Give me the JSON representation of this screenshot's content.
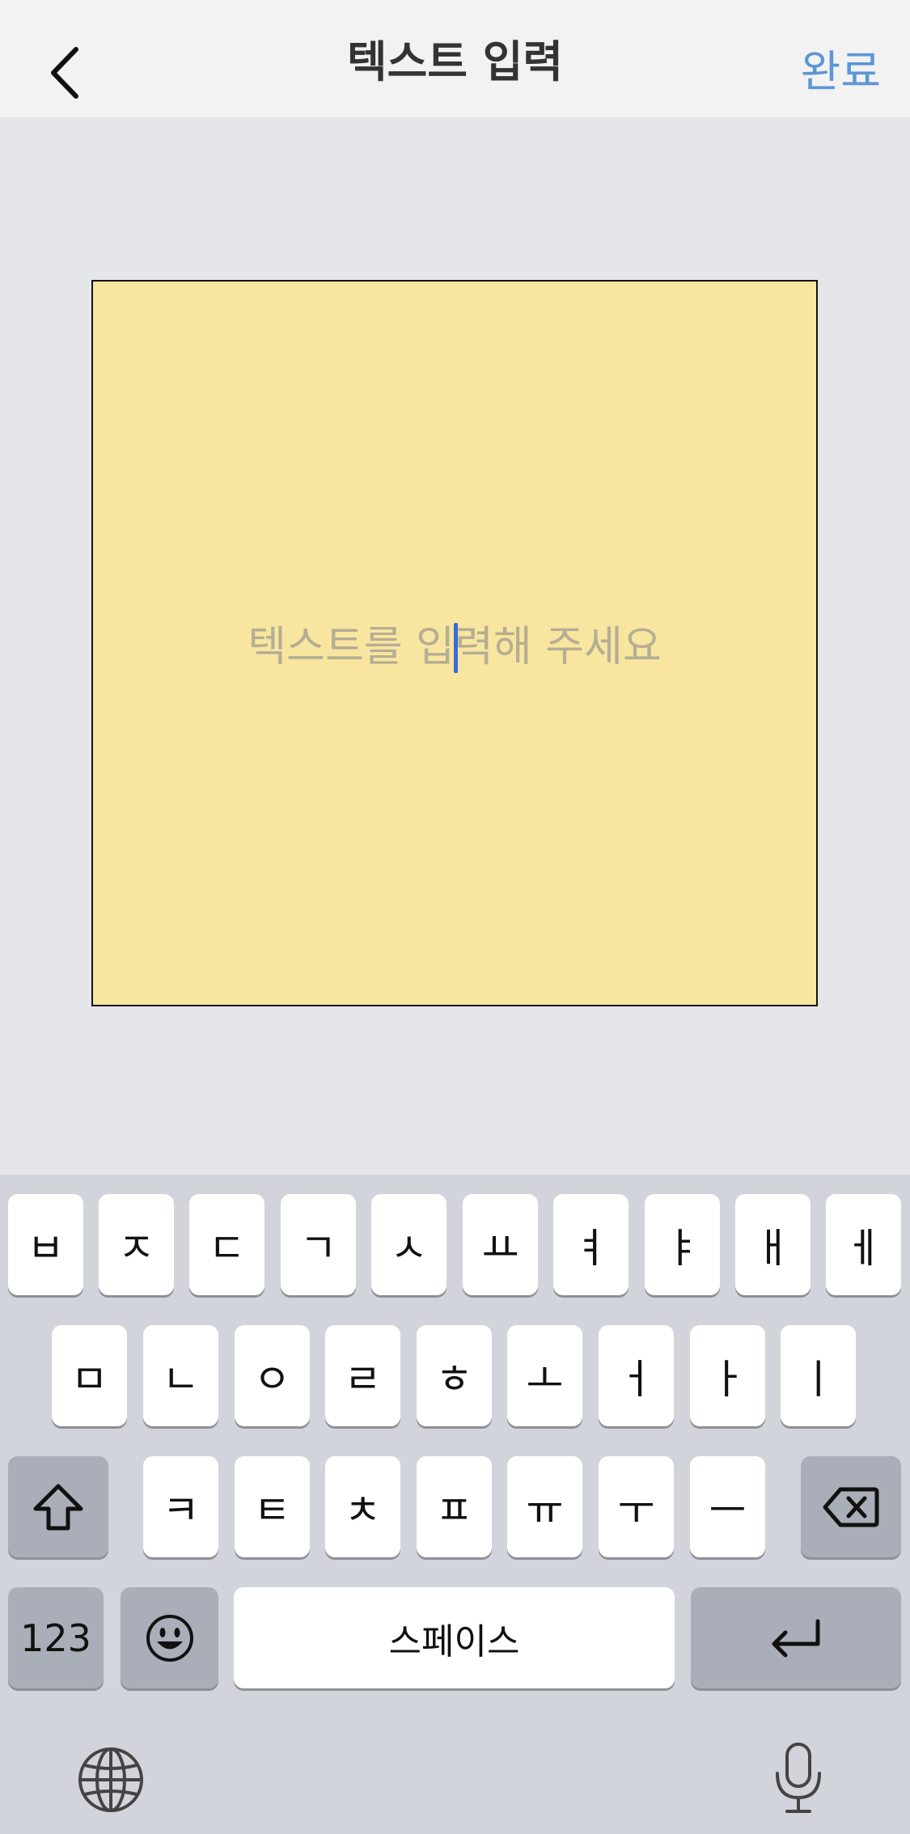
{
  "header": {
    "title": "텍스트 입력",
    "done_label": "완료"
  },
  "editor": {
    "placeholder": "텍스트를 입력해 주세요",
    "background_color": "#f8e59f"
  },
  "keyboard": {
    "row1": [
      "ㅂ",
      "ㅈ",
      "ㄷ",
      "ㄱ",
      "ㅅ",
      "ㅛ",
      "ㅕ",
      "ㅑ",
      "ㅐ",
      "ㅔ"
    ],
    "row2": [
      "ㅁ",
      "ㄴ",
      "ㅇ",
      "ㄹ",
      "ㅎ",
      "ㅗ",
      "ㅓ",
      "ㅏ",
      "ㅣ"
    ],
    "row3": [
      "ㅋ",
      "ㅌ",
      "ㅊ",
      "ㅍ",
      "ㅠ",
      "ㅜ",
      "ㅡ"
    ],
    "numbers_label": "123",
    "space_label": "스페이스",
    "icons": {
      "shift": "shift-icon",
      "delete": "delete-icon",
      "emoji": "emoji-icon",
      "return": "return-icon",
      "globe": "globe-icon",
      "mic": "microphone-icon"
    }
  },
  "accent_color": "#5b97d6"
}
